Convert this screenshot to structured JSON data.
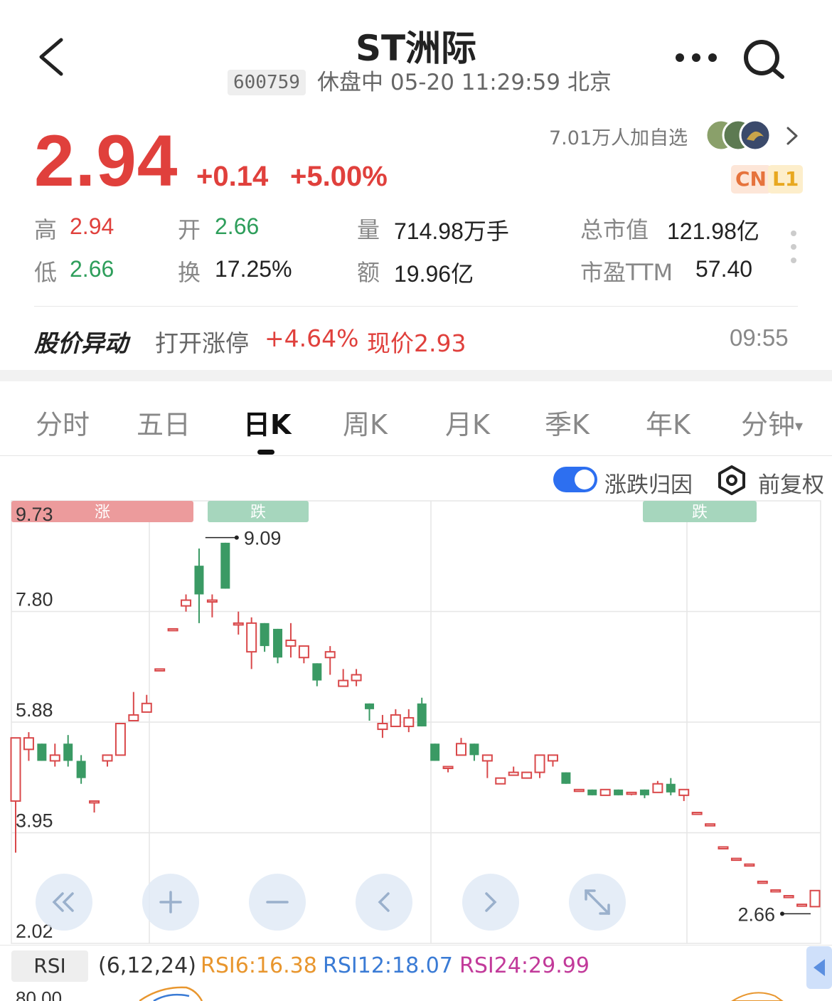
{
  "header": {
    "title": "ST洲际",
    "code": "600759",
    "status": "休盘中 05-20 11:29:59 北京"
  },
  "quote": {
    "price": "2.94",
    "change": "+0.14",
    "change_pct": "+5.00%",
    "watchers": "7.01万人加自选",
    "badge_cn": "CN",
    "badge_l1": "L1"
  },
  "stats": {
    "high_label": "高",
    "high": "2.94",
    "open_label": "开",
    "open": "2.66",
    "volume_label": "量",
    "volume": "714.98万手",
    "mktcap_label": "总市值",
    "mktcap": "121.98亿",
    "low_label": "低",
    "low": "2.66",
    "turnover_label": "换",
    "turnover": "17.25%",
    "amount_label": "额",
    "amount": "19.96亿",
    "pe_label": "市盈TTM",
    "pe": "57.40"
  },
  "anomaly": {
    "title": "股价异动",
    "text": "打开涨停",
    "pct": "+4.64%",
    "now": "现价2.93",
    "time": "09:55"
  },
  "tabs": [
    "分时",
    "五日",
    "日K",
    "周K",
    "月K",
    "季K",
    "年K",
    "分钟"
  ],
  "chart_controls": {
    "toggle_label": "涨跌归因",
    "adjust_label": "前复权"
  },
  "chart_data": {
    "type": "candlestick",
    "y_ticks": [
      "9.73",
      "7.80",
      "5.88",
      "3.95",
      "2.02"
    ],
    "ylim": [
      2.02,
      9.73
    ],
    "attribution_tags": [
      "涨",
      "跌",
      "跌"
    ],
    "max_label": "9.09",
    "min_label": "2.66",
    "candles": [
      [
        4.5,
        5.6,
        3.6,
        5.6
      ],
      [
        5.4,
        5.7,
        5.2,
        5.6
      ],
      [
        5.5,
        5.5,
        5.2,
        5.2
      ],
      [
        5.2,
        5.5,
        5.1,
        5.3
      ],
      [
        5.5,
        5.65,
        5.1,
        5.2
      ],
      [
        5.2,
        5.3,
        4.8,
        4.9
      ],
      [
        4.5,
        4.5,
        4.3,
        4.5
      ],
      [
        5.2,
        5.3,
        5.1,
        5.3
      ],
      [
        5.3,
        5.85,
        5.3,
        5.85
      ],
      [
        5.9,
        6.4,
        5.9,
        6.0
      ],
      [
        6.05,
        6.35,
        6.05,
        6.2
      ],
      [
        6.8,
        6.8,
        6.8,
        6.8
      ],
      [
        7.5,
        7.5,
        7.5,
        7.5
      ],
      [
        7.9,
        8.1,
        7.8,
        8.0
      ],
      [
        8.6,
        8.9,
        7.6,
        8.1
      ],
      [
        8.0,
        8.1,
        7.7,
        8.0
      ],
      [
        9.0,
        9.0,
        8.2,
        8.2
      ],
      [
        7.6,
        7.8,
        7.4,
        7.6
      ],
      [
        7.1,
        7.7,
        6.8,
        7.6
      ],
      [
        7.6,
        7.6,
        7.1,
        7.2
      ],
      [
        7.5,
        7.5,
        6.9,
        7.0
      ],
      [
        7.2,
        7.6,
        7.0,
        7.3
      ],
      [
        7.0,
        7.2,
        6.9,
        7.2
      ],
      [
        6.9,
        6.9,
        6.5,
        6.6
      ],
      [
        7.0,
        7.2,
        6.7,
        7.1
      ],
      [
        6.5,
        6.8,
        6.5,
        6.6
      ],
      [
        6.6,
        6.8,
        6.5,
        6.7
      ],
      [
        6.2,
        6.2,
        5.9,
        6.1
      ],
      [
        5.75,
        6.0,
        5.6,
        5.85
      ],
      [
        5.8,
        6.1,
        5.8,
        6.0
      ],
      [
        5.8,
        6.1,
        5.7,
        5.95
      ],
      [
        6.2,
        6.3,
        5.8,
        5.8
      ],
      [
        5.5,
        5.5,
        5.2,
        5.2
      ],
      [
        5.1,
        5.1,
        5.0,
        5.1
      ],
      [
        5.3,
        5.6,
        5.3,
        5.5
      ],
      [
        5.5,
        5.5,
        5.2,
        5.3
      ],
      [
        5.2,
        5.3,
        4.9,
        5.3
      ],
      [
        4.8,
        4.9,
        4.8,
        4.9
      ],
      [
        4.95,
        5.1,
        4.95,
        5.0
      ],
      [
        4.9,
        5.0,
        4.9,
        5.0
      ],
      [
        5.0,
        5.3,
        4.9,
        5.3
      ],
      [
        5.2,
        5.3,
        5.1,
        5.3
      ],
      [
        5.0,
        5.0,
        4.8,
        4.8
      ],
      [
        4.7,
        4.7,
        4.7,
        4.7
      ],
      [
        4.7,
        4.7,
        4.6,
        4.6
      ],
      [
        4.6,
        4.7,
        4.6,
        4.7
      ],
      [
        4.7,
        4.7,
        4.6,
        4.6
      ],
      [
        4.65,
        4.65,
        4.6,
        4.65
      ],
      [
        4.7,
        4.7,
        4.55,
        4.6
      ],
      [
        4.65,
        4.85,
        4.65,
        4.8
      ],
      [
        4.8,
        4.9,
        4.6,
        4.65
      ],
      [
        4.6,
        4.7,
        4.5,
        4.7
      ],
      [
        4.3,
        4.3,
        4.3,
        4.3
      ],
      [
        4.1,
        4.1,
        4.1,
        4.1
      ],
      [
        3.7,
        3.7,
        3.7,
        3.7
      ],
      [
        3.5,
        3.5,
        3.5,
        3.5
      ],
      [
        3.4,
        3.4,
        3.4,
        3.4
      ],
      [
        3.1,
        3.1,
        3.1,
        3.1
      ],
      [
        2.95,
        2.95,
        2.95,
        2.95
      ],
      [
        2.85,
        2.85,
        2.85,
        2.85
      ],
      [
        2.7,
        2.7,
        2.7,
        2.7
      ],
      [
        2.66,
        2.94,
        2.66,
        2.94
      ]
    ]
  },
  "rsi": {
    "label": "RSI",
    "params": "(6,12,24)",
    "rsi6": "RSI6:16.38",
    "rsi12": "RSI12:18.07",
    "rsi24": "RSI24:29.99",
    "next_tick": "80.00"
  }
}
